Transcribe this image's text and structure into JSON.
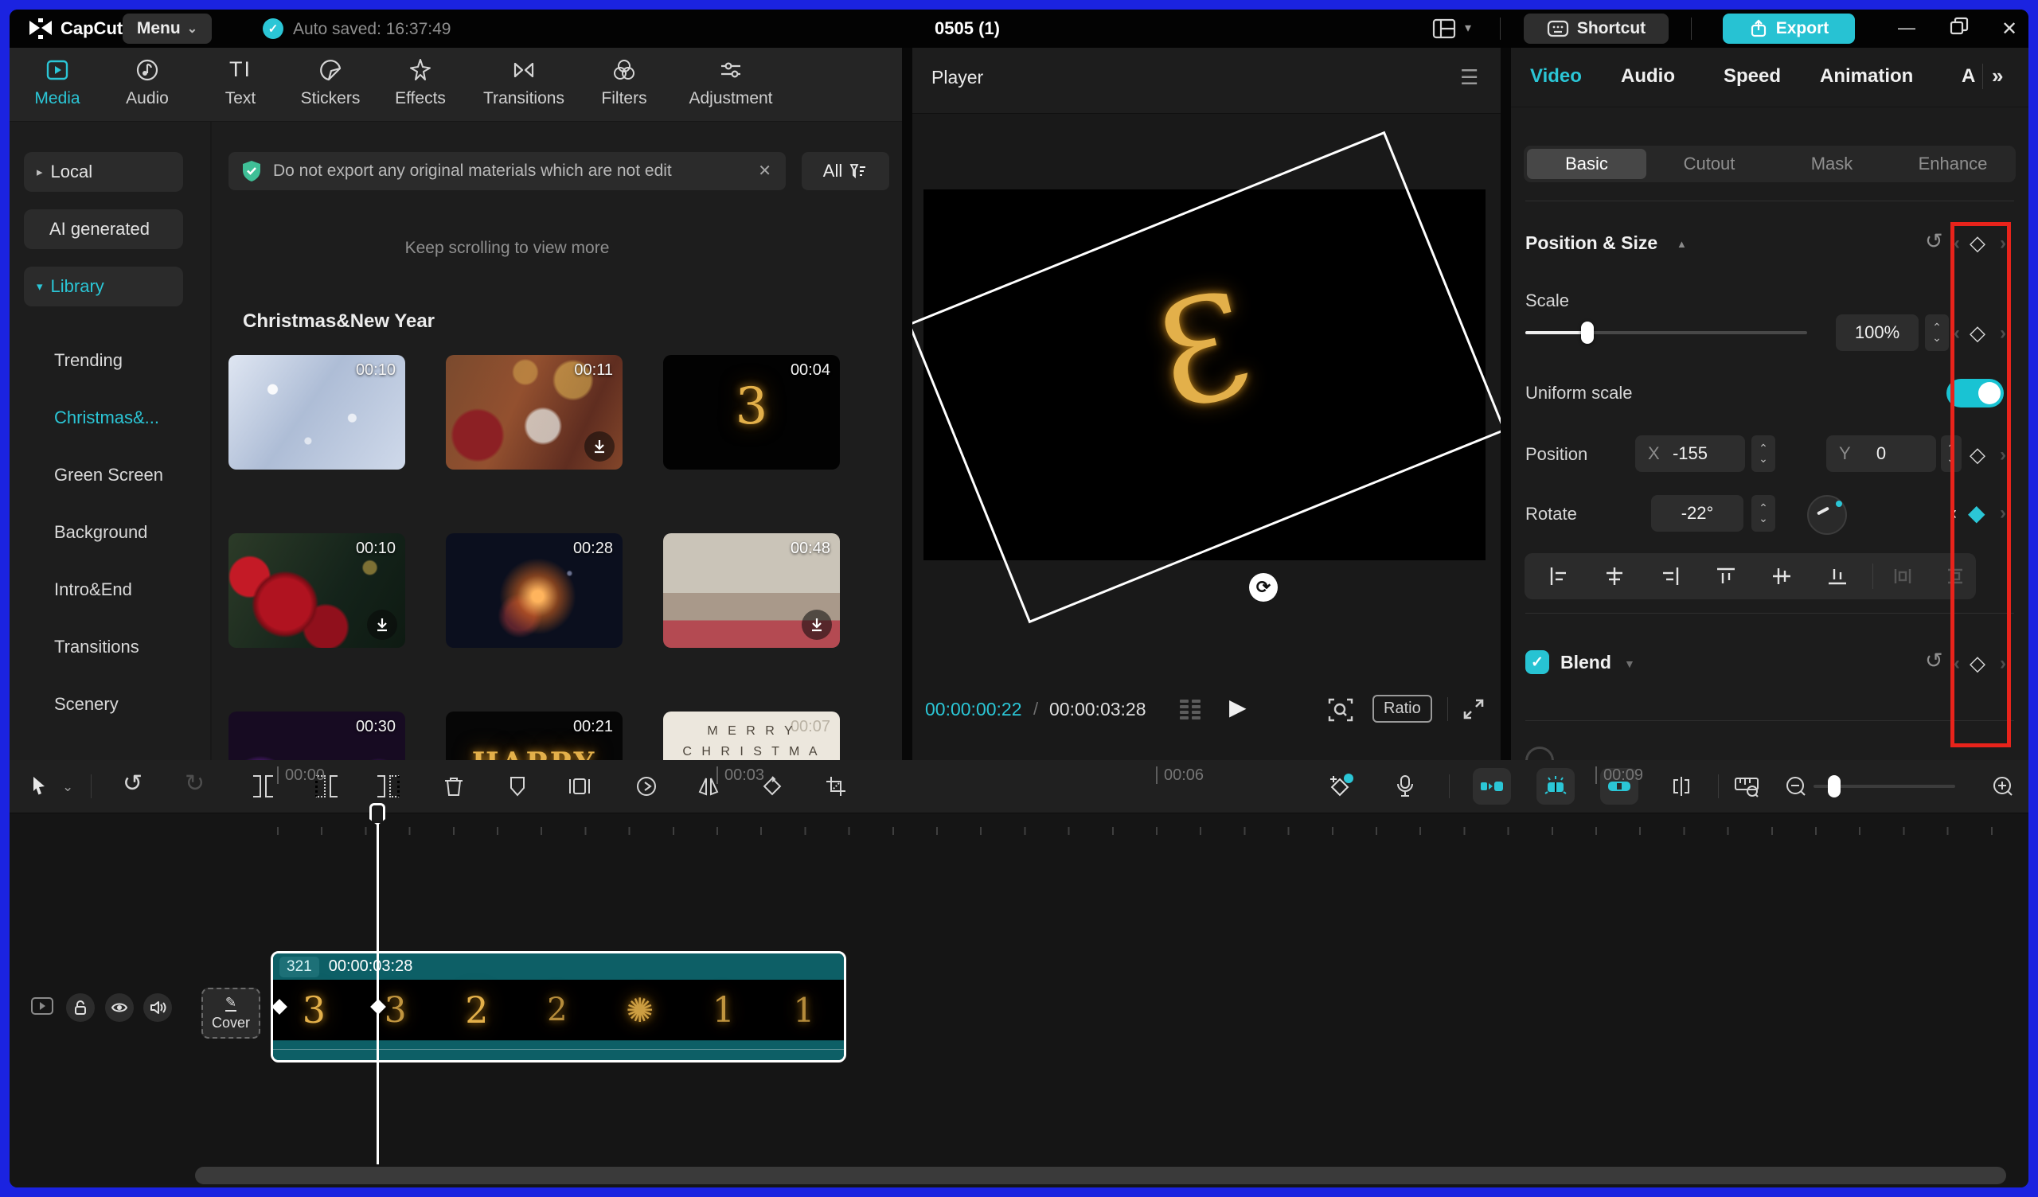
{
  "colors": {
    "accent": "#2bc6d6",
    "frame_blue": "#1b23e0",
    "highlight_red": "#e8231b",
    "clip_teal": "#0d5f66",
    "gold": "#d9a43e",
    "export_bg": "#27c2d3"
  },
  "icons": {
    "close": "✕",
    "caret_down": "⌄",
    "caret_right": "▸",
    "caret_down_filled": "▾",
    "caret_up_filled": "▲",
    "dropdown_filled": "▼",
    "reset": "↺",
    "redo": "↻",
    "diamond": "◇",
    "diamond_filled": "◆",
    "chev_left": "‹",
    "chev_right": "›",
    "check": "✓",
    "play": "▶",
    "hamburger": "☰",
    "window_min": "—",
    "window_max": "❐",
    "stepper_up": "⌃",
    "stepper_down": "⌄",
    "double_chevron": "»",
    "text_tool": "TI",
    "sparkle": "✺",
    "pencil": "✎",
    "rotate_handle": "⟳",
    "slash": "/"
  },
  "titlebar": {
    "app_name": "CapCut",
    "menu": "Menu",
    "autosave": "Auto saved: 16:37:49",
    "doc_title": "0505 (1)",
    "shortcut": "Shortcut",
    "export": "Export"
  },
  "media_tabs": {
    "items": [
      {
        "label": "Media"
      },
      {
        "label": "Audio"
      },
      {
        "label": "Text"
      },
      {
        "label": "Stickers"
      },
      {
        "label": "Effects"
      },
      {
        "label": "Transitions"
      },
      {
        "label": "Filters"
      },
      {
        "label": "Adjustment"
      }
    ]
  },
  "sidebar": {
    "local": "Local",
    "ai_generated": "AI generated",
    "library": "Library",
    "items": [
      {
        "label": "Trending"
      },
      {
        "label": "Christmas&..."
      },
      {
        "label": "Green Screen"
      },
      {
        "label": "Background"
      },
      {
        "label": "Intro&End"
      },
      {
        "label": "Transitions"
      },
      {
        "label": "Scenery"
      }
    ]
  },
  "browser": {
    "notice": "Do not export any original materials which are not edit",
    "filter_all": "All",
    "scroll_hint": "Keep scrolling to view more",
    "section_title": "Christmas&New Year",
    "cards": [
      {
        "duration": "00:10"
      },
      {
        "duration": "00:11"
      },
      {
        "duration": "00:04",
        "overlay": "3"
      },
      {
        "duration": "00:10"
      },
      {
        "duration": "00:28"
      },
      {
        "duration": "00:48"
      },
      {
        "duration": "00:30"
      },
      {
        "duration": "00:21",
        "overlay": "HAPPY"
      },
      {
        "duration": "00:07",
        "line1": "M E R R Y",
        "line2": "C H R I S T M A"
      }
    ]
  },
  "player": {
    "title": "Player",
    "current_time": "00:00:00:22",
    "total_time": "00:00:03:28",
    "ratio": "Ratio",
    "glyph": "Ɛ"
  },
  "inspector": {
    "tabs": [
      {
        "label": "Video"
      },
      {
        "label": "Audio"
      },
      {
        "label": "Speed"
      },
      {
        "label": "Animation"
      },
      {
        "label": "A"
      }
    ],
    "subtabs": [
      {
        "label": "Basic"
      },
      {
        "label": "Cutout"
      },
      {
        "label": "Mask"
      },
      {
        "label": "Enhance"
      }
    ],
    "position_size": {
      "title": "Position & Size",
      "scale_label": "Scale",
      "scale_value": "100%",
      "uniform_label": "Uniform scale",
      "position_label": "Position",
      "x_label": "X",
      "x_value": "-155",
      "y_label": "Y",
      "y_value": "0",
      "rotate_label": "Rotate",
      "rotate_value": "-22°"
    },
    "blend": {
      "label": "Blend"
    }
  },
  "timeline": {
    "ruler_labels": [
      {
        "t": "00:00"
      },
      {
        "t": "00:03"
      },
      {
        "t": "00:06"
      },
      {
        "t": "00:09"
      }
    ],
    "clip": {
      "badge": "321",
      "duration": "00:00:03:28",
      "frames": [
        {
          "g": "3"
        },
        {
          "g": "3"
        },
        {
          "g": "2"
        },
        {
          "g": "2"
        },
        {
          "g": "✺"
        },
        {
          "g": "1"
        },
        {
          "g": "1"
        }
      ]
    },
    "cover_label": "Cover"
  }
}
